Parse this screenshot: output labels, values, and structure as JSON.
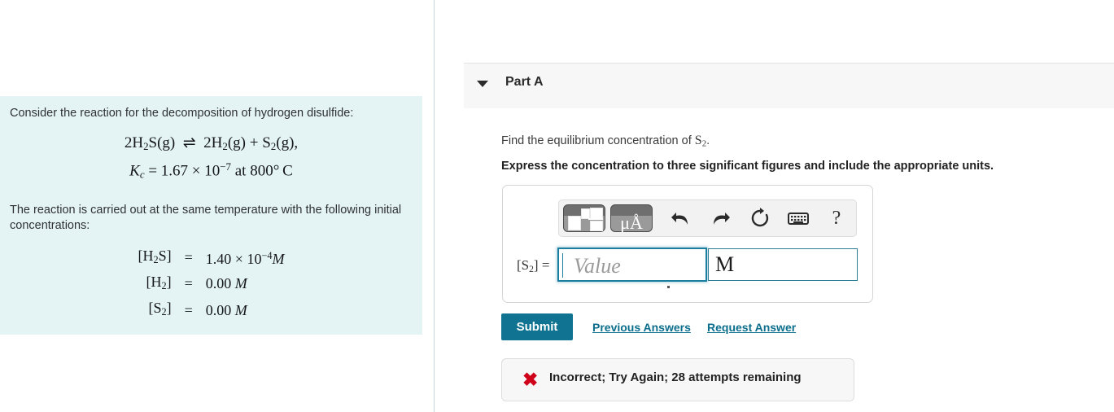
{
  "left_panel": {
    "intro": "Consider the reaction for the decomposition of hydrogen disulfide:",
    "equation": {
      "reaction_left": "2H",
      "reaction_line": "2H2S(g) ⇌ 2H2(g) + S2(g),",
      "kc_line": "Kc = 1.67 × 10−7 at 800°C",
      "kc_symbol": "K",
      "kc_subscript": "c",
      "kc_equals": "=",
      "kc_value": "1.67",
      "kc_times": "×",
      "kc_base": "10",
      "kc_exponent": "−7",
      "kc_condition": "at 800",
      "kc_degree": "°",
      "kc_unit": "C"
    },
    "setup_text": "The reaction is carried out at the same temperature with the following initial concentrations:",
    "concentration_rows": [
      {
        "species": "[H2S]",
        "equals": "=",
        "value": "1.40 × 10−4 M"
      },
      {
        "species": "[H2]",
        "equals": "=",
        "value": "0.00 M"
      },
      {
        "species": "[S2]",
        "equals": "=",
        "value": "0.00 M"
      }
    ]
  },
  "part_header": {
    "title": "Part A",
    "caret_icon": "caret-down-icon"
  },
  "question": {
    "prompt_prefix": "Find the equilibrium concentration of ",
    "prompt_species": "S",
    "prompt_species_sub": "2",
    "prompt_suffix": ".",
    "instruction": "Express the concentration to three significant figures and include the appropriate units."
  },
  "toolbar": {
    "template_icon": "math-template-icon",
    "units_icon": "units-palette-icon",
    "units_label": "μÅ",
    "undo_icon": "undo-arrow-icon",
    "redo_icon": "redo-arrow-icon",
    "reset_icon": "reset-circular-arrow-icon",
    "keyboard_icon": "keyboard-icon",
    "help_icon": "question-mark-icon",
    "help_label": "?"
  },
  "answer_field": {
    "label_species": "[S",
    "label_sub": "2",
    "label_close": "] =",
    "value": "",
    "placeholder": "Value",
    "units_value": "M"
  },
  "actions": {
    "submit_label": "Submit",
    "previous_answers_label": "Previous Answers",
    "request_answer_label": "Request Answer"
  },
  "feedback": {
    "icon": "red-x-icon",
    "icon_glyph": "✖",
    "message": "Incorrect; Try Again; 28 attempts remaining",
    "attempts_remaining": 28
  },
  "colors": {
    "accent_teal": "#0f7391",
    "link_teal": "#0a6e8c",
    "problem_bg": "#e4f4f4",
    "header_bg": "#f7f7f7",
    "error_red": "#d0021b",
    "field_focus": "#1a7f9e"
  }
}
